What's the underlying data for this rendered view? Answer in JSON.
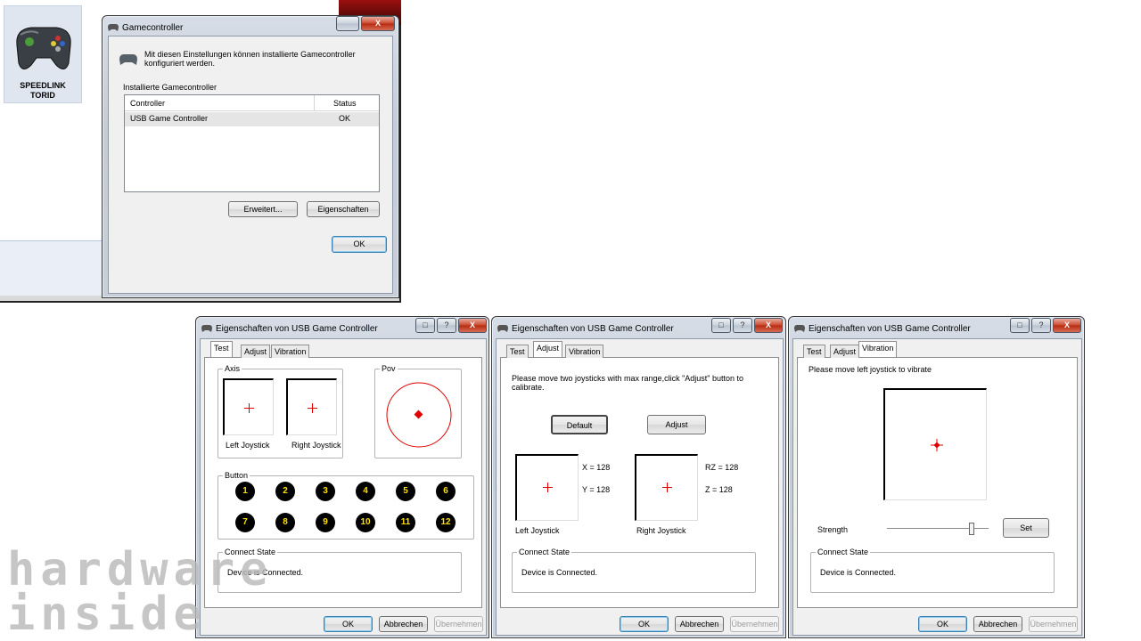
{
  "desktop": {
    "icon_label": "SPEEDLINK\nTORID"
  },
  "gamecontroller_window": {
    "title": "Gamecontroller",
    "intro": "Mit diesen Einstellungen können installierte Gamecontroller konfiguriert werden.",
    "group_label": "Installierte Gamecontroller",
    "columns": [
      "Controller",
      "Status"
    ],
    "rows": [
      {
        "controller": "USB Game Controller",
        "status": "OK"
      }
    ],
    "advanced_button": "Erweitert...",
    "properties_button": "Eigenschaften",
    "ok_button": "OK",
    "titlebar_buttons": {
      "help": "",
      "close": "X"
    }
  },
  "properties_title": "Eigenschaften von USB Game Controller",
  "tabs": [
    "Test",
    "Adjust",
    "Vibration"
  ],
  "titlebar_buttons": {
    "help": "?",
    "close": "X"
  },
  "footer": {
    "ok": "OK",
    "cancel": "Abbrechen",
    "apply": "Übernehmen"
  },
  "test_tab": {
    "axis_label": "Axis",
    "pov_label": "Pov",
    "left_joystick": "Left Joystick",
    "right_joystick": "Right Joystick",
    "button_label": "Button",
    "buttons": [
      "1",
      "2",
      "3",
      "4",
      "5",
      "6",
      "7",
      "8",
      "9",
      "10",
      "11",
      "12"
    ],
    "connect_label": "Connect State",
    "connect_text": "Device is Connected."
  },
  "adjust_tab": {
    "instruction": "Please move two joysticks with max range,click \"Adjust\" button to calibrate.",
    "default_button": "Default",
    "adjust_button": "Adjust",
    "x_value": "X = 128",
    "y_value": "Y = 128",
    "rz_value": "RZ = 128",
    "z_value": "Z = 128",
    "left_joystick": "Left Joystick",
    "right_joystick": "Right Joystick",
    "connect_label": "Connect State",
    "connect_text": "Device is Connected."
  },
  "vibration_tab": {
    "instruction": "Please move left joystick to vibrate",
    "strength_label": "Strength",
    "strength_level": 0.85,
    "set_button": "Set",
    "connect_label": "Connect State",
    "connect_text": "Device is Connected."
  },
  "watermark": {
    "line1": "hardware",
    "line2": "inside"
  },
  "colors": {
    "accent_red": "#e00000",
    "button_yellow": "#ffe000",
    "window_frame": "#c4ccd6"
  }
}
